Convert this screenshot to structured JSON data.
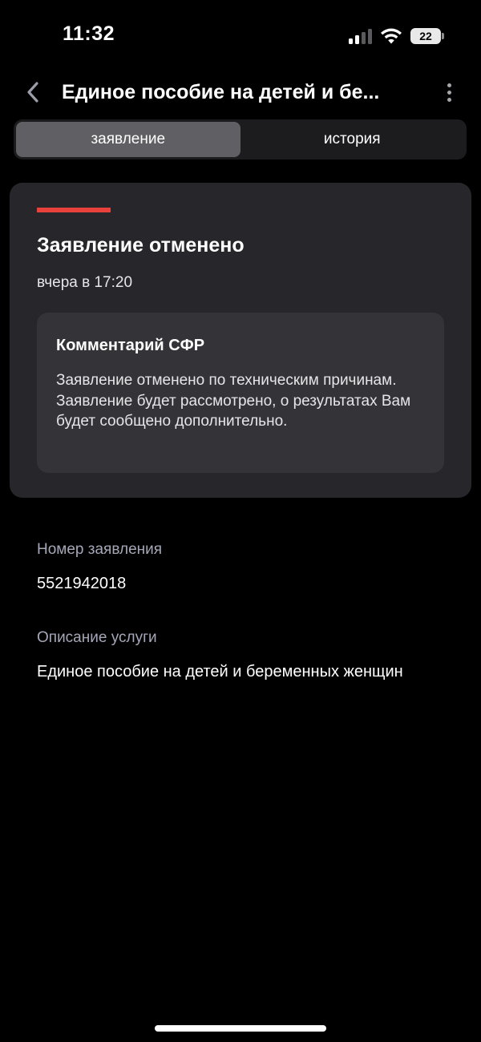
{
  "status_bar": {
    "time": "11:32",
    "battery_level": "22",
    "icons": [
      "cellular-signal-icon",
      "wifi-icon",
      "battery-icon"
    ]
  },
  "header": {
    "title": "Единое пособие на детей и бе...",
    "back_icon": "chevron-left-icon",
    "more_icon": "more-vertical-icon"
  },
  "tabs": [
    {
      "label": "заявление",
      "active": true
    },
    {
      "label": "история",
      "active": false
    }
  ],
  "status_card": {
    "title": "Заявление отменено",
    "timestamp": "вчера в 17:20",
    "accent_color": "#e8413b",
    "comment": {
      "title": "Комментарий СФР",
      "text": "Заявление отменено по техническим причинам. Заявление будет рассмотрено, о результатах Вам будет сообщено дополнительно."
    }
  },
  "details": {
    "application_number_label": "Номер заявления",
    "application_number": "5521942018",
    "service_description_label": "Описание услуги",
    "service_description": "Единое пособие на детей и беременных женщин"
  },
  "colors": {
    "background": "#000000",
    "card": "#27272b",
    "comment_box": "#333338",
    "active_tab": "#5f5f64",
    "label": "#a5a7b8"
  }
}
